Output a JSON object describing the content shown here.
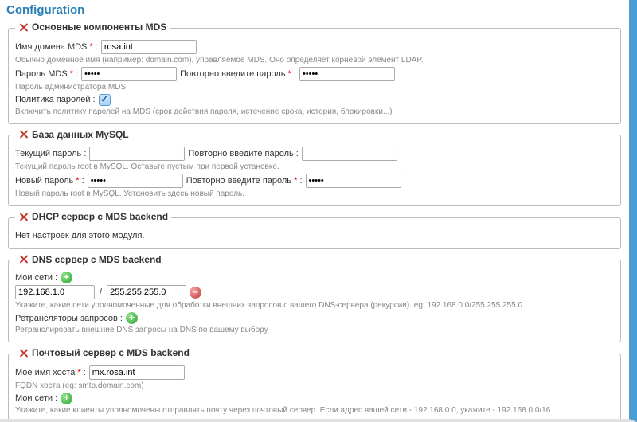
{
  "title": "Configuration",
  "sections": {
    "mds_core": {
      "legend": "Основные компоненты MDS",
      "domain_label": "Имя домена MDS",
      "domain_value": "rosa.int",
      "domain_hint": "Обычно доменное имя (например: domain.com), управляемое MDS. Оно определяет корневой элемент LDAP.",
      "pwd_label": "Пароль MDS",
      "pwd_value": "•••••",
      "pwd_repeat_label": "Повторно введите пароль",
      "pwd_repeat_value": "•••••",
      "pwd_hint": "Пароль администратора MDS.",
      "policy_label": "Политика паролей :",
      "policy_checked": true,
      "policy_hint": "Включить политику паролей на MDS (срок действия пароля, истечение срока, история, блокировки...)"
    },
    "mysql": {
      "legend": "База данных MySQL",
      "cur_label": "Текущий пароль :",
      "cur_value": "",
      "cur_repeat_label": "Повторно введите пароль :",
      "cur_repeat_value": "",
      "cur_hint": "Текущий пароль root в MySQL. Оставьте пустым при первой установке.",
      "new_label": "Новый пароль",
      "new_value": "•••••",
      "new_repeat_label": "Повторно введите пароль",
      "new_repeat_value": "•••••",
      "new_hint": "Новый пароль root в MySQL. Установить здесь новый пароль."
    },
    "dhcp": {
      "legend": "DHCP сервер с MDS backend",
      "empty": "Нет настроек для этого модуля."
    },
    "dns": {
      "legend": "DNS сервер с MDS backend",
      "nets_label": "Мои сети :",
      "net_addr": "192.168.1.0",
      "net_mask": "255.255.255.0",
      "nets_hint": "Укажите, какие сети уполномоченные для обработки внешних запросов с вашего DNS-сервера (рекурсии). eg: 192.168.0.0/255.255.255.0.",
      "relay_label": "Ретрансляторы запросов :",
      "relay_hint": "Ретранслировать внешние DNS запросы на DNS по вашему выбору"
    },
    "mail": {
      "legend": "Почтовый сервер с MDS backend",
      "host_label": "Мое имя хоста",
      "host_value": "mx.rosa.int",
      "host_hint": "FQDN хоста (eg: smtp.domain.com)",
      "nets_label": "Мои сети :",
      "nets_hint": "Укажите, какие клиенты уполномочены отправлять почту через почтовый сервер. Если адрес вашей сети - 192.168.0.0, укажите - 192.168.0.0/16"
    }
  },
  "colon": " :"
}
